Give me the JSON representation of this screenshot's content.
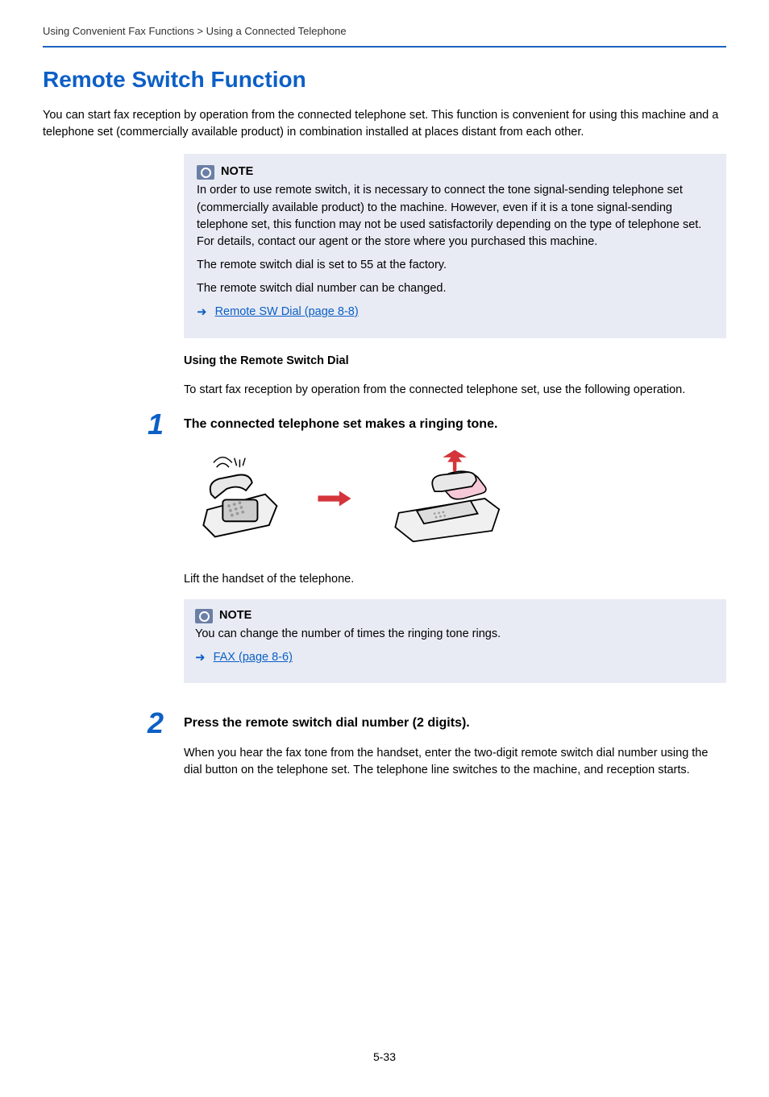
{
  "breadcrumb": "Using Convenient Fax Functions > Using a Connected Telephone",
  "title": "Remote Switch Function",
  "intro": "You can start fax reception by operation from the connected telephone set. This function is convenient for using this machine and a telephone set (commercially available product) in combination installed at places distant from each other.",
  "note1": {
    "label": "NOTE",
    "para1": "In order to use remote switch, it is necessary to connect the tone signal-sending telephone set (commercially available product) to the machine. However, even if it is a tone signal-sending telephone set, this function may not be used satisfactorily depending on the type of telephone set. For details, contact our agent or the store where you purchased this machine.",
    "para2": "The remote switch dial is set to 55 at the factory.",
    "para3": "The remote switch dial number can be changed.",
    "link": "Remote SW Dial (page 8-8)"
  },
  "subhead": "Using the Remote Switch Dial",
  "subintro": "To start fax reception by operation from the connected telephone set, use the following operation.",
  "step1": {
    "num": "1",
    "title": "The connected telephone set makes a ringing tone.",
    "after_illus": "Lift the handset of the telephone.",
    "note": {
      "label": "NOTE",
      "text": "You can change the number of times the ringing tone rings.",
      "link": "FAX (page 8-6)"
    }
  },
  "step2": {
    "num": "2",
    "title": "Press the remote switch dial number (2 digits).",
    "body": "When you hear the fax tone from the handset, enter the two-digit remote switch dial number using the dial button on the telephone set. The telephone line switches to the machine, and reception starts."
  },
  "page_number": "5-33"
}
